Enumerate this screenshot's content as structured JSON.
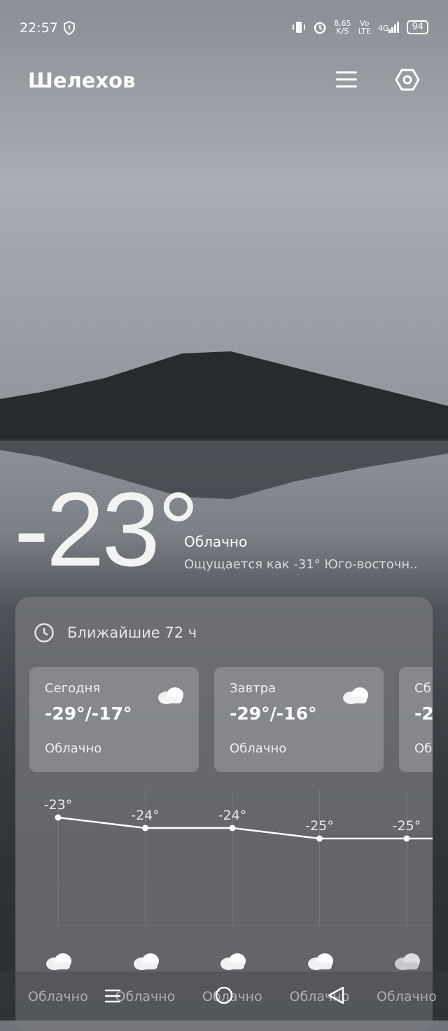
{
  "status": {
    "time": "22:57",
    "net_speed_top": "8,65",
    "net_speed_unit": "K/S",
    "vo": "Vo",
    "lte": "LTE",
    "signal": "4G",
    "battery": "94"
  },
  "header": {
    "city": "Шелехов"
  },
  "current": {
    "temperature": "-23°",
    "condition": "Облачно",
    "feels": "Ощущается как -31° Юго-восточн.."
  },
  "forecast": {
    "title": "Ближайшие 72 ч",
    "days": [
      {
        "name": "Сегодня",
        "range": "-29°/-17°",
        "desc": "Облачно"
      },
      {
        "name": "Завтра",
        "range": "-29°/-16°",
        "desc": "Облачно"
      },
      {
        "name": "Сб",
        "range": "-2",
        "desc": "Об"
      }
    ]
  },
  "chart_data": {
    "type": "line",
    "x": [
      "1",
      "2",
      "3",
      "4",
      "5"
    ],
    "values": [
      -23,
      -24,
      -24,
      -25,
      -25
    ],
    "labels": [
      "-23°",
      "-24°",
      "-24°",
      "-25°",
      "-25°"
    ],
    "conditions": [
      "Облачно",
      "Облачно",
      "Облачно",
      "Облачно",
      "Облачно"
    ]
  }
}
